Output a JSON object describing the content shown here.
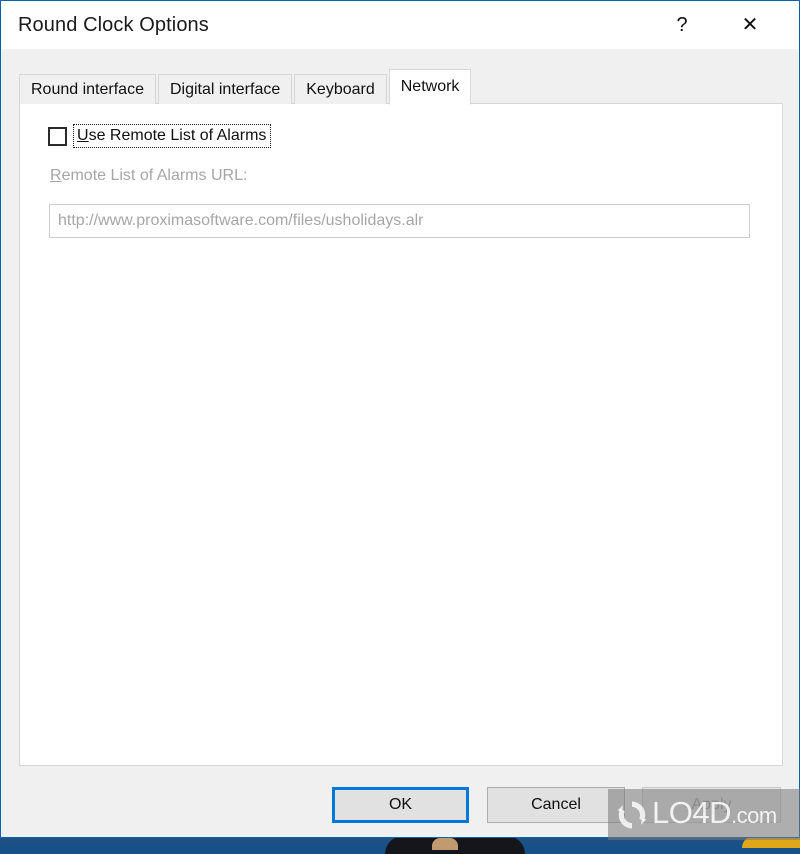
{
  "window": {
    "title": "Round Clock Options",
    "help_glyph": "?",
    "close_glyph": "✕",
    "border_color": "#0a64ad"
  },
  "tabs": [
    {
      "label": "Round interface",
      "active": false
    },
    {
      "label": "Digital interface",
      "active": false
    },
    {
      "label": "Keyboard",
      "active": false
    },
    {
      "label": "Network",
      "active": true
    }
  ],
  "network_tab": {
    "checkbox": {
      "label_accel": "U",
      "label_rest": "se Remote List of Alarms",
      "checked": false,
      "focused": true
    },
    "url_label": {
      "accel": "R",
      "rest": "emote List of Alarms URL:",
      "disabled": true
    },
    "url_field": {
      "value": "http://www.proximasoftware.com/files/usholidays.alr",
      "placeholder": "http://",
      "disabled": true
    }
  },
  "buttons": {
    "ok": {
      "label": "OK",
      "default": true,
      "focus_color": "#0078d7"
    },
    "cancel": {
      "label": "Cancel",
      "default": false
    },
    "apply": {
      "label": "Apply",
      "disabled": true
    }
  },
  "watermark": {
    "name": "LO4D",
    "suffix": ".com"
  }
}
